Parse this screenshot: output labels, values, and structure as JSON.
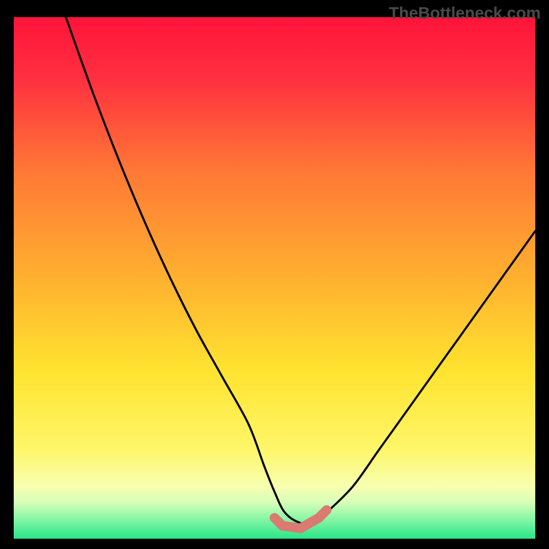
{
  "watermark": "TheBottleneck.com",
  "colors": {
    "background": "#000000",
    "curve": "#000000",
    "highlight": "#db7a70",
    "gradient": [
      "#ff143a",
      "#ff3040",
      "#ff7a35",
      "#ffb030",
      "#ffe430",
      "#fff66a",
      "#f7ffb0",
      "#d8ffb8",
      "#8cf7a8",
      "#28e58a"
    ]
  },
  "chart_data": {
    "type": "line",
    "title": "",
    "xlabel": "",
    "ylabel": "",
    "xlim": [
      0,
      100
    ],
    "ylim": [
      0,
      100
    ],
    "x": [
      10,
      15,
      20,
      25,
      30,
      35,
      40,
      45,
      48,
      50,
      52,
      55,
      58,
      60,
      65,
      70,
      75,
      80,
      85,
      90,
      95,
      100
    ],
    "values": [
      100,
      86,
      73,
      61,
      50,
      40,
      31,
      22,
      14,
      9,
      5,
      3,
      3,
      5,
      10,
      17,
      24,
      31,
      38,
      45,
      52,
      59
    ],
    "annotations": {
      "optimal_zone_x": [
        50,
        60
      ],
      "optimal_zone_y": [
        3,
        5
      ]
    }
  }
}
